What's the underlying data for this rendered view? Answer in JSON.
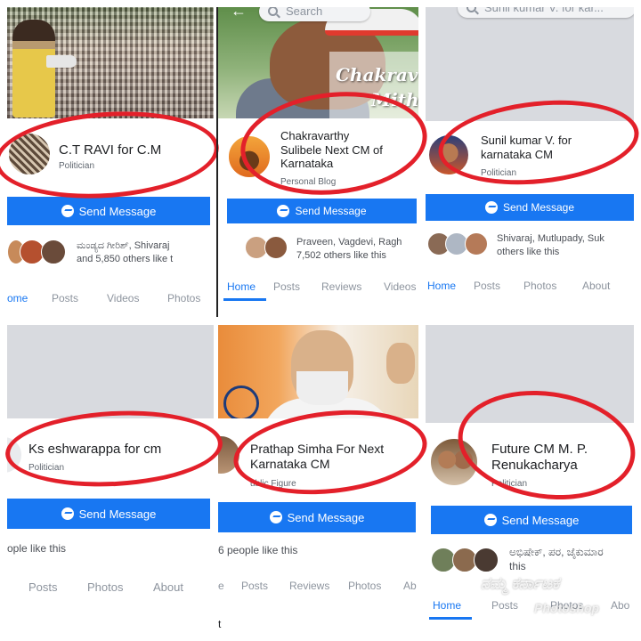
{
  "panels": [
    {
      "page_name": "C.T RAVI for C.M",
      "category": "Politician",
      "send_button": "Send Message",
      "likes_text": "ಮಂಡ್ಯದ ಗೀರಿಶ್, Shivaraj\nand 5,850 others like t",
      "tabs": [
        "ome",
        "Posts",
        "Videos",
        "Photos"
      ]
    },
    {
      "page_name": "Chakravarthy\nSulibele Next CM of\nKarnataka",
      "category": "Personal Blog",
      "cover_text": [
        "Chakrav",
        "Mith"
      ],
      "send_button": "Send Message",
      "likes_text": "Praveen, Vagdevi, Ragh\n7,502 others like this",
      "tabs": [
        "Home",
        "Posts",
        "Reviews",
        "Videos"
      ],
      "search_placeholder": "Search"
    },
    {
      "page_name": "Sunil kumar V. for\nkarnataka CM",
      "category": "Politician",
      "send_button": "Send Message",
      "likes_text": "Shivaraj, Mutlupady, Suk\nothers like this",
      "tabs": [
        "Home",
        "Posts",
        "Photos",
        "About"
      ],
      "search_placeholder": "Sunil kumar V. for kar..."
    },
    {
      "page_name": "Ks eshwarappa for cm",
      "category": "Politician",
      "send_button": "Send Message",
      "likes_text": "ople like this",
      "tabs": [
        "Posts",
        "Photos",
        "About"
      ]
    },
    {
      "page_name": "Prathap Simha For Next\nKarnataka CM",
      "category": "ublic Figure",
      "send_button": "Send Message",
      "likes_text": "6 people like this",
      "tabs": [
        "e",
        "Posts",
        "Reviews",
        "Photos",
        "Ab"
      ],
      "footer_fragment": "t"
    },
    {
      "page_name": "Future CM  M. P.\nRenukacharya",
      "category": "Politician",
      "send_button": "Send Message",
      "likes_text": "ಅಭಿಷೇಕ್, ಪರ, ಜೈಕುಮಾರ\nthis",
      "tabs": [
        "Home",
        "Posts",
        "Photos",
        "Abo"
      ]
    }
  ],
  "watermark": [
    "ನಮ್ಮ ಕರ್ನಾಟಕ",
    "Photoshop"
  ],
  "colors": {
    "fb_blue": "#1877f2",
    "highlight_red": "#e3202a"
  }
}
